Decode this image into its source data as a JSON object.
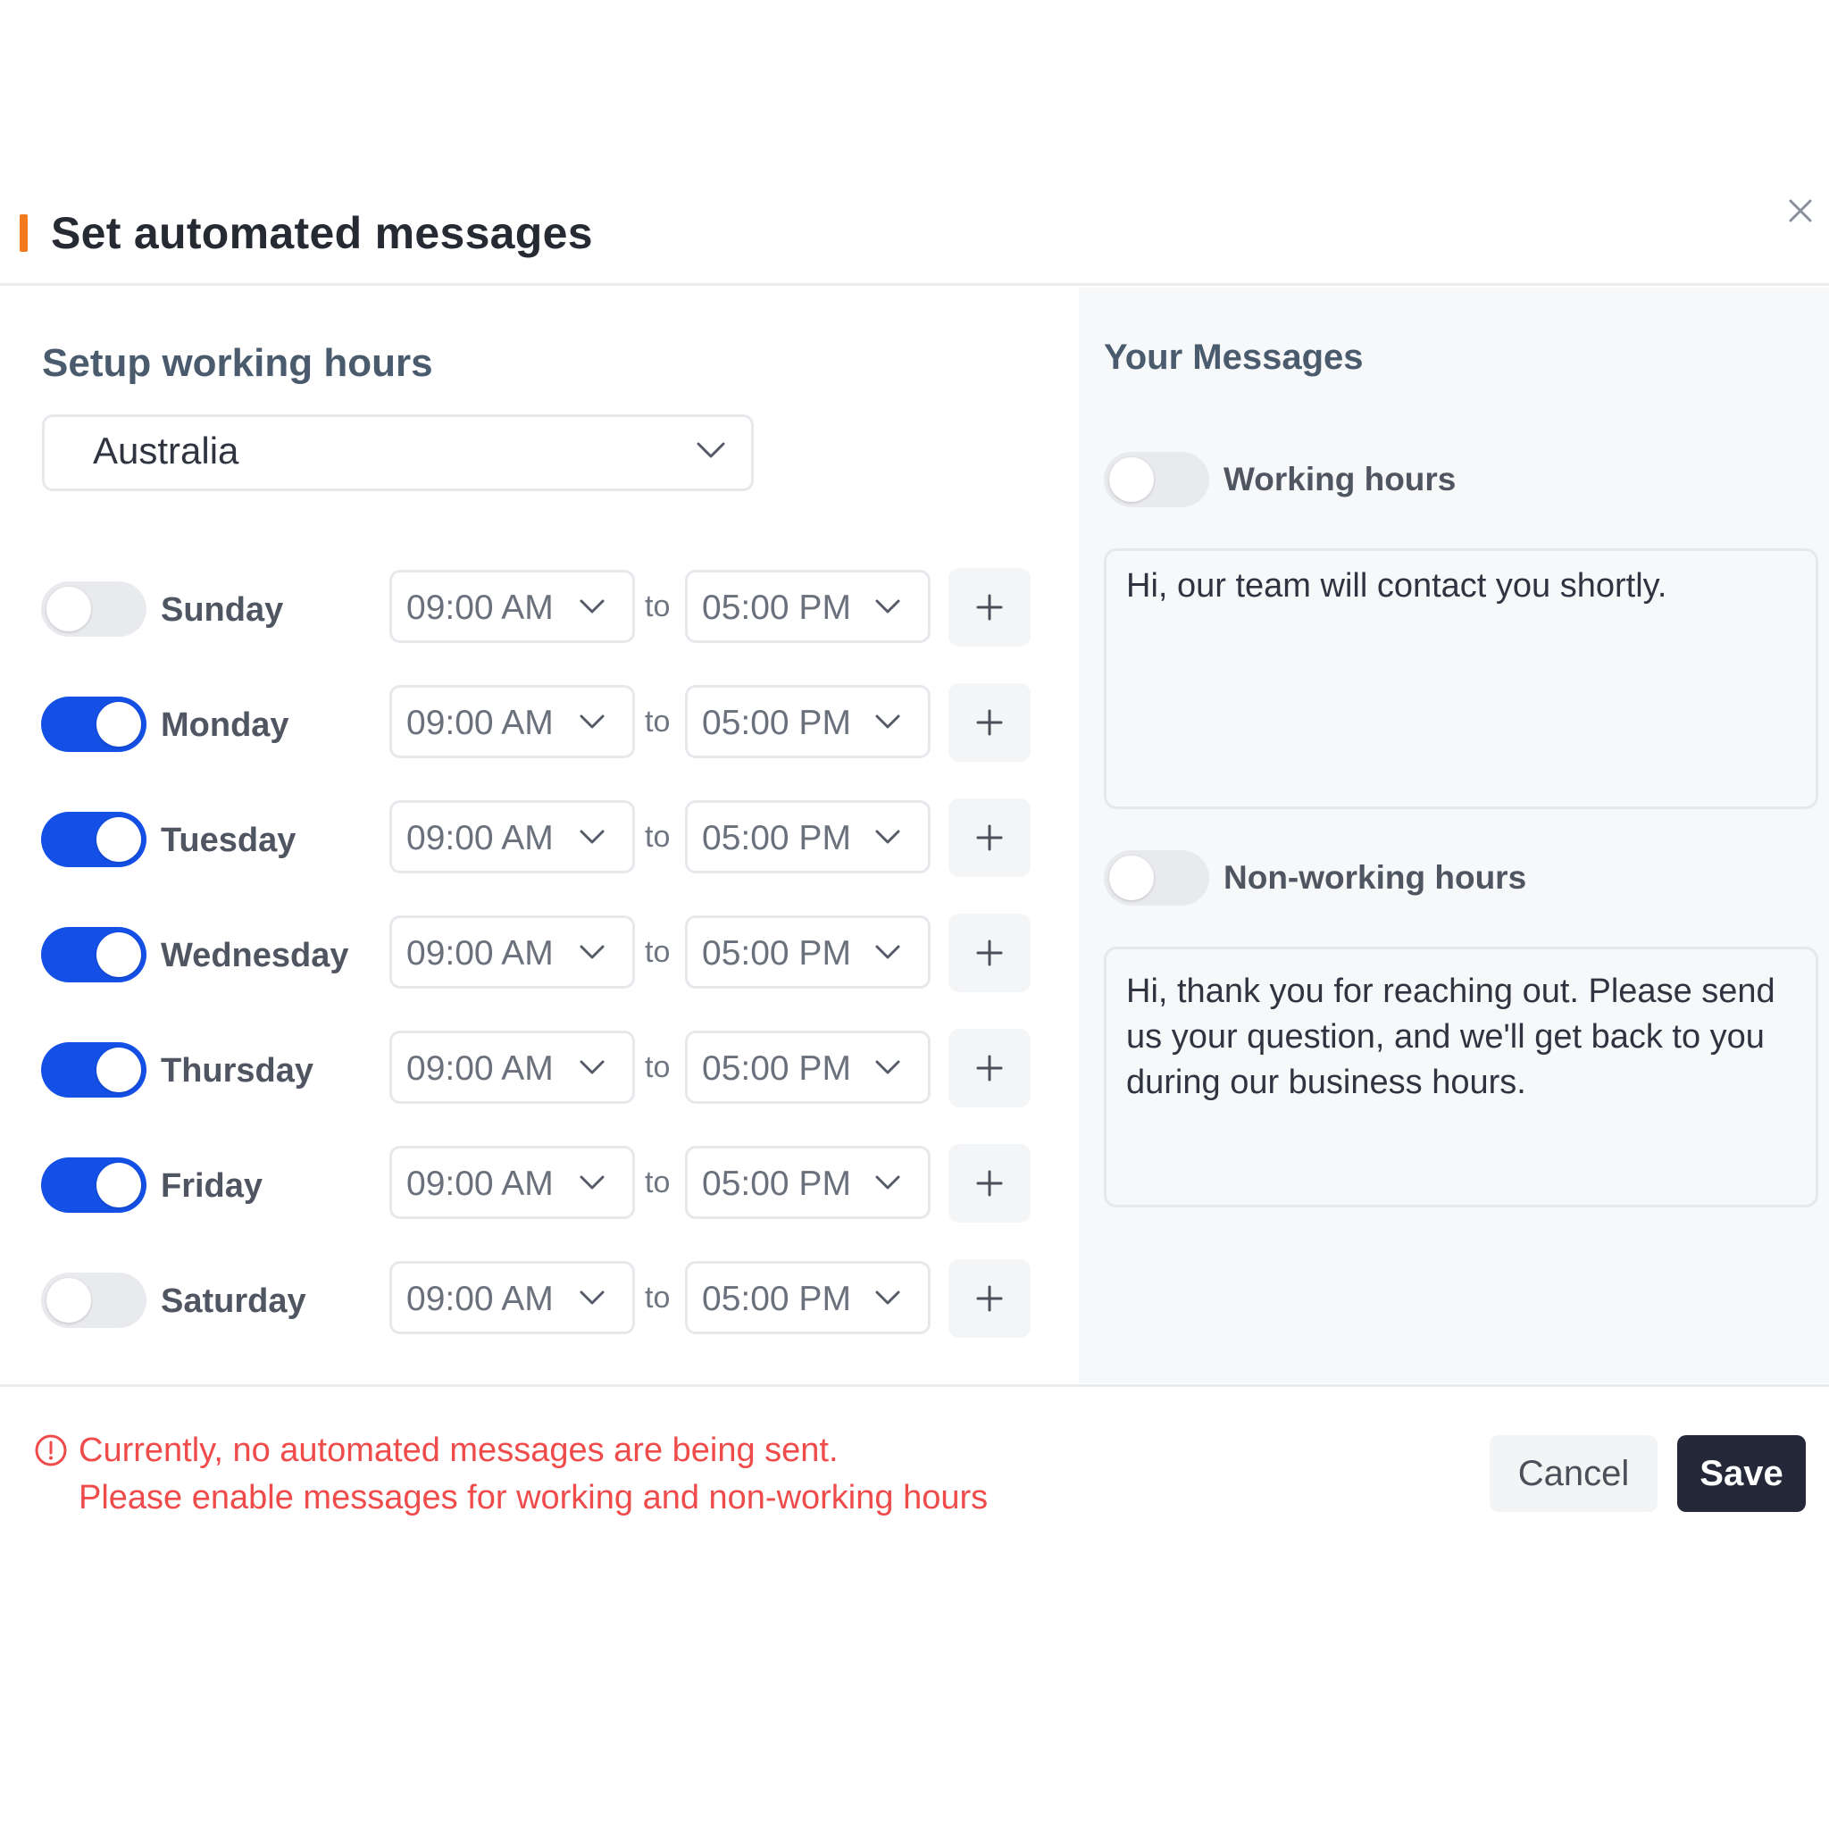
{
  "dialog": {
    "title": "Set automated messages",
    "accent_color": "#f07a1d"
  },
  "working_hours": {
    "section_title": "Setup working hours",
    "region": "Australia",
    "to_label": "to",
    "days": [
      {
        "name": "Sunday",
        "enabled": false,
        "from": "09:00 AM",
        "to": "05:00 PM"
      },
      {
        "name": "Monday",
        "enabled": true,
        "from": "09:00 AM",
        "to": "05:00 PM"
      },
      {
        "name": "Tuesday",
        "enabled": true,
        "from": "09:00 AM",
        "to": "05:00 PM"
      },
      {
        "name": "Wednesday",
        "enabled": true,
        "from": "09:00 AM",
        "to": "05:00 PM"
      },
      {
        "name": "Thursday",
        "enabled": true,
        "from": "09:00 AM",
        "to": "05:00 PM"
      },
      {
        "name": "Friday",
        "enabled": true,
        "from": "09:00 AM",
        "to": "05:00 PM"
      },
      {
        "name": "Saturday",
        "enabled": false,
        "from": "09:00 AM",
        "to": "05:00 PM"
      }
    ]
  },
  "messages": {
    "title": "Your Messages",
    "working": {
      "label": "Working hours",
      "enabled": false,
      "text": "Hi, our team will contact you shortly."
    },
    "non_working": {
      "label": "Non-working hours",
      "enabled": false,
      "text": "Hi, thank you for reaching out. Please send us your question, and we'll get back to you during our business hours."
    }
  },
  "footer": {
    "warning_line1": "Currently, no automated messages are being sent.",
    "warning_line2": "Please enable messages for working and non-working hours",
    "cancel_label": "Cancel",
    "save_label": "Save"
  },
  "colors": {
    "toggle_on": "#1450e6",
    "warning": "#ef4b4b",
    "save_bg": "#242838"
  },
  "icons": {
    "close": "close-icon",
    "chevron": "chevron-down-icon",
    "plus": "plus-icon",
    "warning": "alert-circle-icon"
  }
}
